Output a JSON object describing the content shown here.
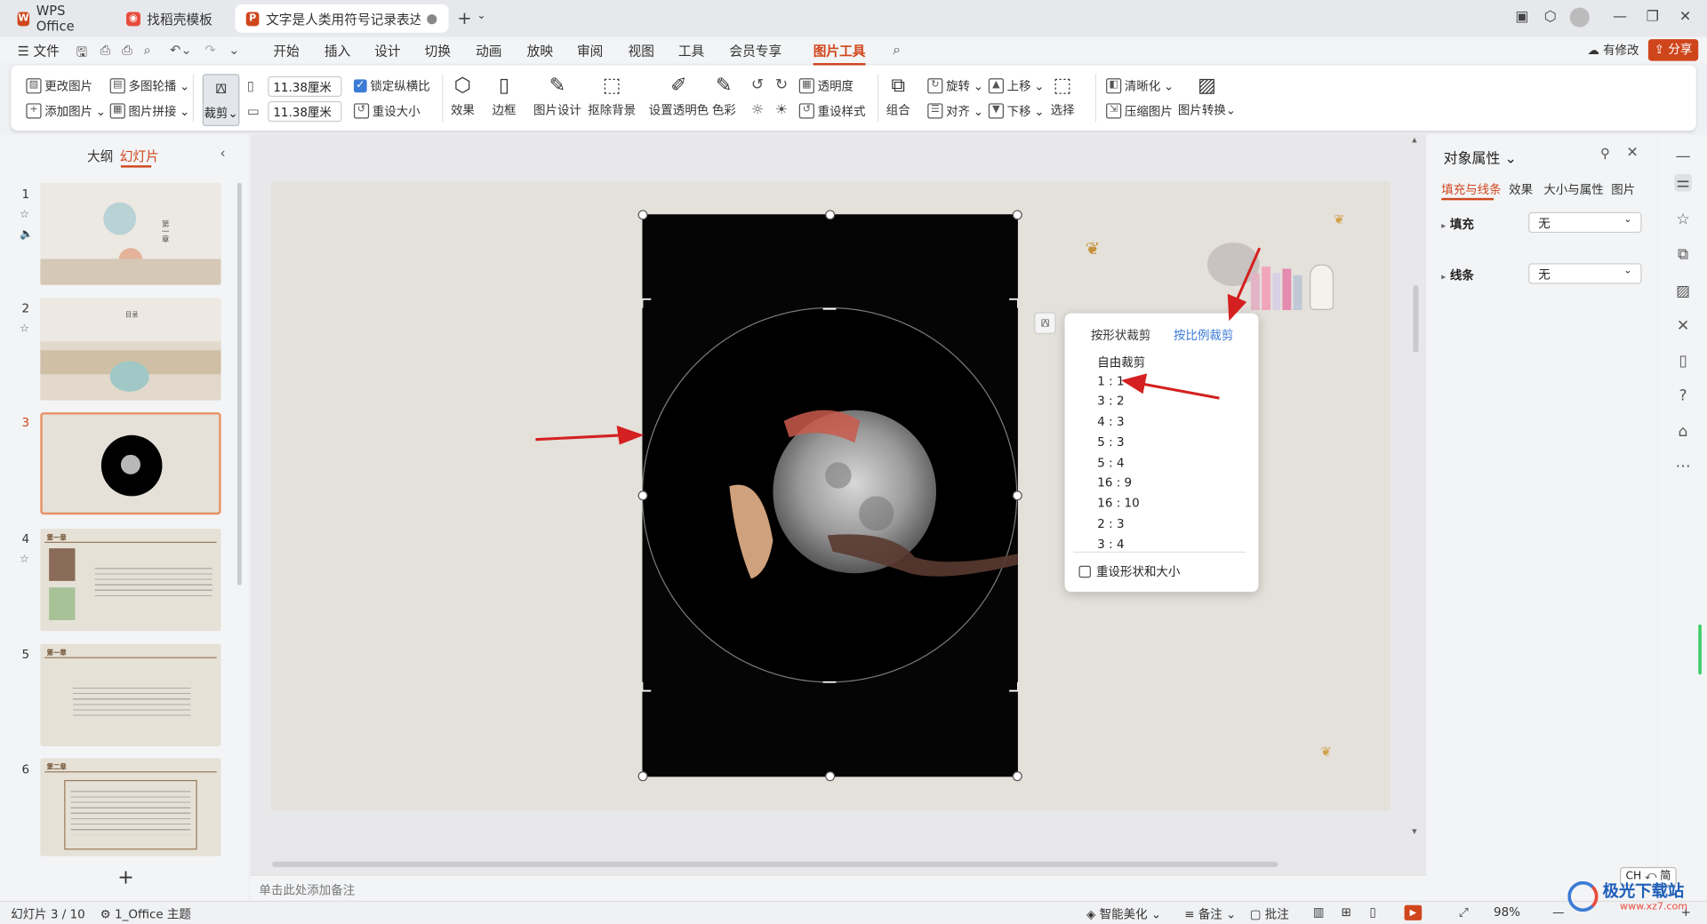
{
  "tabs": [
    {
      "label": "WPS Office"
    },
    {
      "label": "找稻壳模板"
    },
    {
      "label": "文字是人类用符号记录表达信息以"
    }
  ],
  "menu": {
    "file": "文件",
    "items": [
      "开始",
      "插入",
      "设计",
      "切换",
      "动画",
      "放映",
      "审阅",
      "视图",
      "工具",
      "会员专享",
      "图片工具"
    ],
    "has_changes": "有修改",
    "share": "分享"
  },
  "ribbon": {
    "change_pic": "更改图片",
    "multi_carousel": "多图轮播",
    "add_pic": "添加图片",
    "pic_collage": "图片拼接",
    "crop": "裁剪",
    "width": "11.38厘米",
    "height": "11.38厘米",
    "lock_ratio": "锁定纵横比",
    "reset_size": "重设大小",
    "effects": "效果",
    "border": "边框",
    "pic_design": "图片设计",
    "remove_bg": "抠除背景",
    "set_transparent": "设置透明色",
    "color": "色彩",
    "transparency": "透明度",
    "reset_style": "重设样式",
    "group": "组合",
    "rotate": "旋转",
    "align": "对齐",
    "up": "上移",
    "down": "下移",
    "select": "选择",
    "sharpen": "清晰化",
    "compress": "压缩图片",
    "convert": "图片转换"
  },
  "left_panel": {
    "tab_outline": "大纲",
    "tab_slides": "幻灯片",
    "slides": [
      {
        "num": "1"
      },
      {
        "num": "2"
      },
      {
        "num": "3"
      },
      {
        "num": "4",
        "heading": "第一章"
      },
      {
        "num": "5",
        "heading": "第一章"
      },
      {
        "num": "6",
        "heading": "第二章"
      }
    ],
    "title_slide_text": "第一章",
    "contents_text": "目录"
  },
  "crop_popup": {
    "tab_shape": "按形状裁剪",
    "tab_ratio": "按比例裁剪",
    "free": "自由裁剪",
    "ratios": [
      "1 : 1",
      "3 : 2",
      "4 : 3",
      "5 : 3",
      "5 : 4",
      "16 : 9",
      "16 : 10",
      "2 : 3",
      "3 : 4"
    ],
    "reset": "重设形状和大小"
  },
  "right_panel": {
    "title": "对象属性",
    "tabs": [
      "填充与线条",
      "效果",
      "大小与属性",
      "图片"
    ],
    "fill_label": "填充",
    "fill_value": "无",
    "line_label": "线条",
    "line_value": "无"
  },
  "notes_placeholder": "单击此处添加备注",
  "status": {
    "slide_pos": "幻灯片 3 / 10",
    "theme": "1_Office 主题",
    "smart": "智能美化",
    "notes": "备注",
    "comments": "批注",
    "zoom": "98%",
    "ime": "CH ⤺ 简"
  },
  "watermark": {
    "name": "极光下载站",
    "url": "www.xz7.com"
  },
  "colors": {
    "accent": "#d0461c",
    "blue": "#3b7bd6",
    "arrow": "#d42020"
  }
}
